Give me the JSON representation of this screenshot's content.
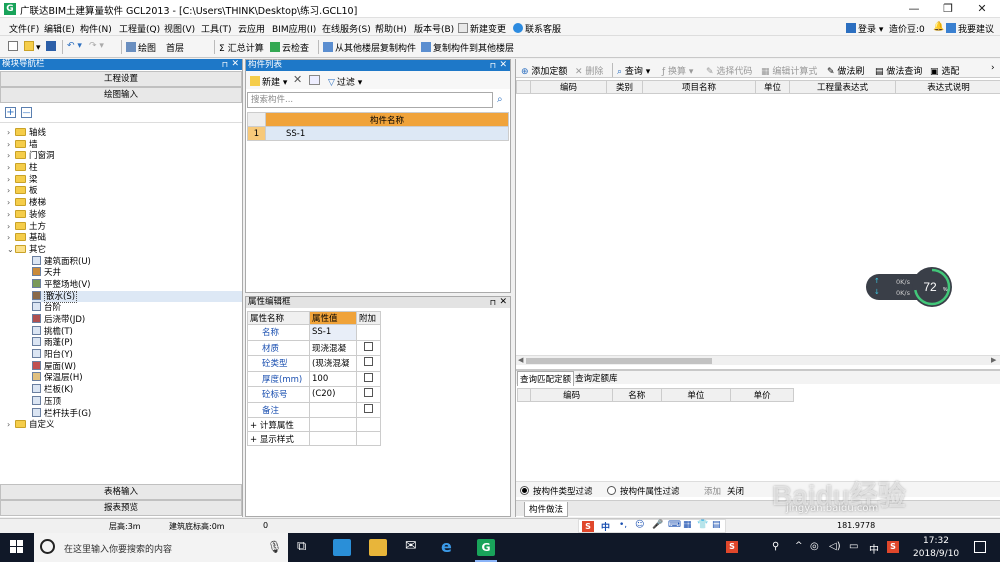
{
  "window": {
    "title": "广联达BIM土建算量软件 GCL2013 - [C:\\Users\\THINK\\Desktop\\练习.GCL10]",
    "min": "—",
    "max": "❐",
    "close": "✕"
  },
  "menu": {
    "items": [
      "文件(F)",
      "编辑(E)",
      "构件(N)",
      "工程量(Q)",
      "视图(V)",
      "工具(T)",
      "云应用",
      "BIM应用(I)",
      "在线服务(S)",
      "帮助(H)",
      "版本号(B)",
      "新建变更",
      "联系客服"
    ],
    "login": "登录",
    "cost_bean": "造价豆:0",
    "bell": "🔔",
    "suggest": "我要建议"
  },
  "toolbar": {
    "draw": "绘图",
    "floor": "首层",
    "sum": "汇总计算",
    "cloud_check": "云检查",
    "copy_from": "从其他楼层复制构件",
    "copy_to": "复制构件到其他楼层"
  },
  "nav": {
    "title": "模块导航栏",
    "btn_project": "工程设置",
    "btn_draw": "绘图输入",
    "plus": "+",
    "minus": "—",
    "tree": [
      {
        "label": "轴线",
        "type": "folder",
        "expanded": false
      },
      {
        "label": "墙",
        "type": "folder",
        "expanded": false
      },
      {
        "label": "门窗洞",
        "type": "folder",
        "expanded": false
      },
      {
        "label": "柱",
        "type": "folder",
        "expanded": false
      },
      {
        "label": "梁",
        "type": "folder",
        "expanded": false
      },
      {
        "label": "板",
        "type": "folder",
        "expanded": false
      },
      {
        "label": "楼梯",
        "type": "folder",
        "expanded": false
      },
      {
        "label": "装修",
        "type": "folder",
        "expanded": false
      },
      {
        "label": "土方",
        "type": "folder",
        "expanded": false
      },
      {
        "label": "基础",
        "type": "folder",
        "expanded": false
      },
      {
        "label": "其它",
        "type": "folder",
        "expanded": true
      }
    ],
    "subtree": [
      "建筑面积(U)",
      "天井",
      "平整场地(V)",
      "散水(S)",
      "台阶",
      "后浇带(JD)",
      "挑檐(T)",
      "雨蓬(P)",
      "阳台(Y)",
      "屋面(W)",
      "保温层(H)",
      "栏板(K)",
      "压顶",
      "栏杆扶手(G)"
    ],
    "selected_sub": "散水(S)",
    "custom": "自定义",
    "btn_table": "表格输入",
    "btn_report": "报表预览"
  },
  "comp_list": {
    "title": "构件列表",
    "new": "新建",
    "filter": "过滤",
    "search_placeholder": "搜索构件...",
    "col_header": "构件名称",
    "rows": [
      {
        "idx": "1",
        "name": "SS-1"
      }
    ]
  },
  "attr": {
    "title": "属性编辑框",
    "col_name": "属性名称",
    "col_value": "属性值",
    "col_extra": "附加",
    "rows": [
      {
        "name": "名称",
        "value": "SS-1",
        "check": false
      },
      {
        "name": "材质",
        "value": "现浇混凝",
        "check": true
      },
      {
        "name": "砼类型",
        "value": "(现浇混凝",
        "check": true
      },
      {
        "name": "厚度(mm)",
        "value": "100",
        "check": true
      },
      {
        "name": "砼标号",
        "value": "(C20)",
        "check": true
      },
      {
        "name": "备注",
        "value": "",
        "check": true
      }
    ],
    "groups": [
      "计算属性",
      "显示样式"
    ]
  },
  "quota": {
    "toolbar": [
      "添加定额",
      "删除",
      "查询",
      "换算",
      "选择代码",
      "编辑计算式",
      "做法刷",
      "做法查询",
      "选配"
    ],
    "columns": [
      "编码",
      "类别",
      "项目名称",
      "单位",
      "工程量表达式",
      "表达式说明"
    ],
    "tab1": "查询匹配定额",
    "tab2": "查询定额库",
    "bottom_columns": [
      "编码",
      "名称",
      "单位",
      "单价"
    ],
    "radio1": "按构件类型过滤",
    "radio2": "按构件属性过滤",
    "add": "添加",
    "close": "关闭",
    "tab_bottom": "构件做法"
  },
  "speed": {
    "up": "0K/s",
    "down": "0K/s",
    "percent": 72
  },
  "status": {
    "floor_height": "层高:3m",
    "base_elev": "建筑底标高:0m",
    "zero": "0",
    "coord": "181.9778"
  },
  "taskbar": {
    "search_placeholder": "在这里输入你要搜索的内容",
    "time": "17:32",
    "date": "2018/9/10",
    "ime": "中"
  },
  "watermark": {
    "logo": "Baidu经验",
    "url": "jingyan.baidu.com"
  },
  "colors": {
    "panel_blue": "#1e78c8",
    "grid_orange": "#f0a33a",
    "taskbar": "#101828",
    "accent_green": "#19a35a"
  }
}
